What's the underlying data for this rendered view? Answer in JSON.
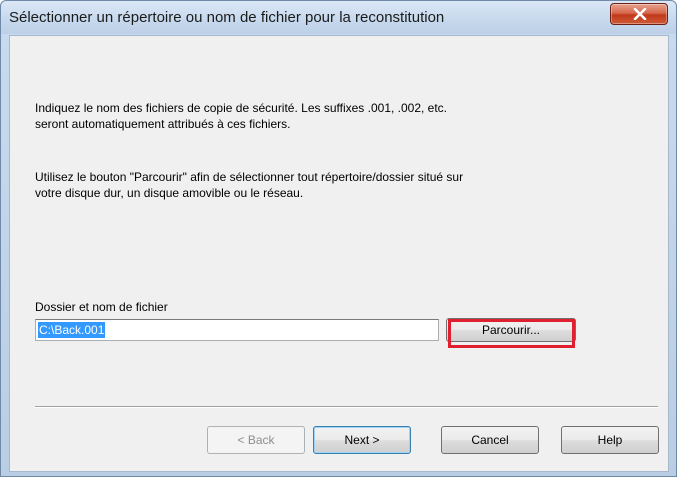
{
  "window": {
    "title": "Sélectionner un répertoire ou nom de fichier pour la reconstitution"
  },
  "content": {
    "paragraph1": {
      "line1": "Indiquez le nom des fichiers de copie de sécurité. Les suffixes .001, .002, etc.",
      "line2": "seront automatiquement attribués à ces fichiers."
    },
    "paragraph2": {
      "line1": "Utilisez le bouton \"Parcourir\" afin de sélectionner tout répertoire/dossier situé sur",
      "line2": "votre disque dur, un disque amovible ou le réseau."
    },
    "field": {
      "label": "Dossier et nom de fichier",
      "value": "C:\\Back.001"
    },
    "browse_label": "Parcourir..."
  },
  "buttons": {
    "back": "< Back",
    "next": "Next >",
    "cancel": "Cancel",
    "help": "Help"
  },
  "colors": {
    "highlight": "#e0202e",
    "selection": "#3399ff"
  }
}
